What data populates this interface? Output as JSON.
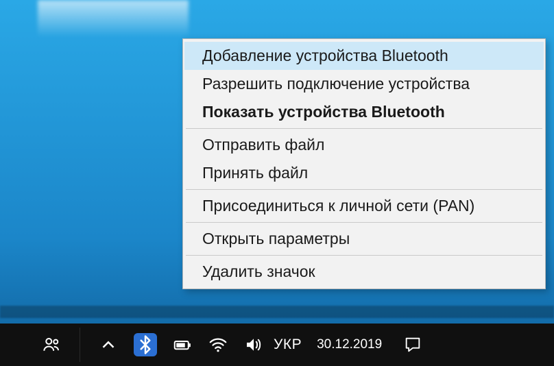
{
  "menu": {
    "items": [
      {
        "label": "Добавление устройства Bluetooth",
        "bold": false,
        "highlight": true
      },
      {
        "label": "Разрешить подключение устройства",
        "bold": false
      },
      {
        "label": "Показать устройства Bluetooth",
        "bold": true
      }
    ],
    "group2": [
      {
        "label": "Отправить файл"
      },
      {
        "label": "Принять файл"
      }
    ],
    "group3": [
      {
        "label": "Присоединиться к личной сети (PAN)"
      }
    ],
    "group4": [
      {
        "label": "Открыть параметры"
      }
    ],
    "group5": [
      {
        "label": "Удалить значок"
      }
    ]
  },
  "taskbar": {
    "language": "УКР",
    "date": "30.12.2019"
  }
}
